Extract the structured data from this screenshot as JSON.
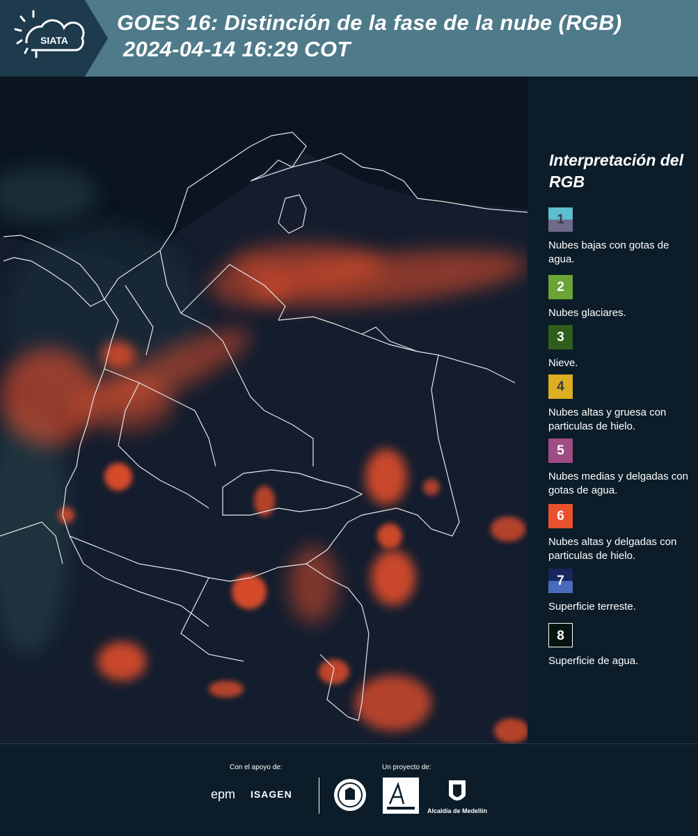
{
  "header": {
    "logo_text": "SIATA",
    "title_line1": "GOES 16: Distinción de la fase de la nube (RGB)",
    "title_line2": "2024-04-14 16:29 COT"
  },
  "legend": {
    "title": "Interpretación del RGB",
    "items": [
      {
        "number": "1",
        "label": "Nubes bajas con gotas de agua.",
        "color_top": "#5bbfcf",
        "color_bottom": "#6f6a8a"
      },
      {
        "number": "2",
        "label": "Nubes glaciares.",
        "color": "#6aa436"
      },
      {
        "number": "3",
        "label": "Nieve.",
        "color": "#2f5e1c"
      },
      {
        "number": "4",
        "label": "Nubes altas y gruesa con particulas de hielo.",
        "color": "#dcae21"
      },
      {
        "number": "5",
        "label": "Nubes medias y delgadas con gotas de agua.",
        "color": "#a04c84"
      },
      {
        "number": "6",
        "label": "Nubes altas y delgadas con particulas de hielo.",
        "color": "#e9502c"
      },
      {
        "number": "7",
        "label": "Superficie terreste.",
        "color_top": "#17265e",
        "color_bottom": "#4a6bbd"
      },
      {
        "number": "8",
        "label": "Superficie de agua.",
        "color": "#061510"
      }
    ]
  },
  "footer": {
    "support_label": "Con el apoyo de:",
    "project_label": "Un proyecto de:",
    "sponsor_1": "epm",
    "sponsor_2": "ISAGEN",
    "partner_3": "Alcaldía de Medellín"
  }
}
